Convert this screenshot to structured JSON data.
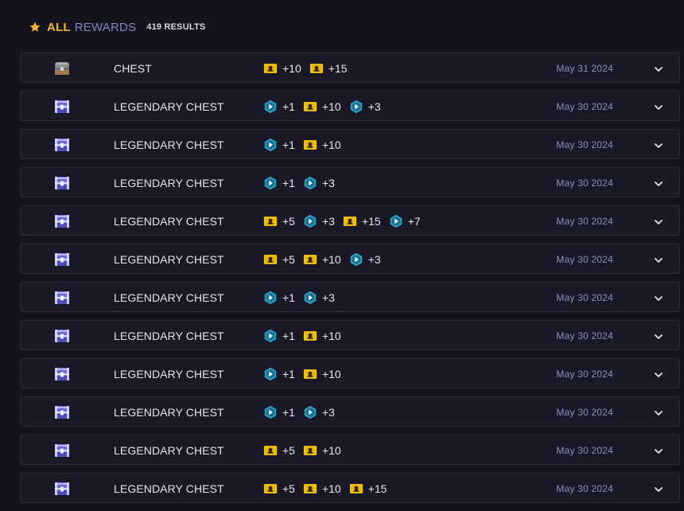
{
  "header": {
    "all_label": "ALL",
    "rewards_label": "REWARDS",
    "results_label": "419 RESULTS"
  },
  "colors": {
    "accent": "#f3b23a",
    "muted": "#7f86c0",
    "date": "#8a8fc4",
    "row_bg": "#191927",
    "page_bg": "#14141f"
  },
  "icons": {
    "star": "star-icon",
    "ticket": "ticket-icon",
    "hex": "hex-token-icon",
    "chest": "chest-icon",
    "legendary_chest": "legendary-chest-icon",
    "chevron": "chevron-down-icon"
  },
  "rows": [
    {
      "name": "CHEST",
      "chest": "chest",
      "date": "May 31 2024",
      "items": [
        {
          "icon": "ticket",
          "amount": "+10"
        },
        {
          "icon": "ticket",
          "amount": "+15"
        }
      ]
    },
    {
      "name": "LEGENDARY CHEST",
      "chest": "legendary",
      "date": "May 30 2024",
      "items": [
        {
          "icon": "hex",
          "amount": "+1"
        },
        {
          "icon": "ticket",
          "amount": "+10"
        },
        {
          "icon": "hex",
          "amount": "+3"
        }
      ]
    },
    {
      "name": "LEGENDARY CHEST",
      "chest": "legendary",
      "date": "May 30 2024",
      "items": [
        {
          "icon": "hex",
          "amount": "+1"
        },
        {
          "icon": "ticket",
          "amount": "+10"
        }
      ]
    },
    {
      "name": "LEGENDARY CHEST",
      "chest": "legendary",
      "date": "May 30 2024",
      "items": [
        {
          "icon": "hex",
          "amount": "+1"
        },
        {
          "icon": "hex",
          "amount": "+3"
        }
      ]
    },
    {
      "name": "LEGENDARY CHEST",
      "chest": "legendary",
      "date": "May 30 2024",
      "items": [
        {
          "icon": "ticket",
          "amount": "+5"
        },
        {
          "icon": "hex",
          "amount": "+3"
        },
        {
          "icon": "ticket",
          "amount": "+15"
        },
        {
          "icon": "hex",
          "amount": "+7"
        }
      ]
    },
    {
      "name": "LEGENDARY CHEST",
      "chest": "legendary",
      "date": "May 30 2024",
      "items": [
        {
          "icon": "ticket",
          "amount": "+5"
        },
        {
          "icon": "ticket",
          "amount": "+10"
        },
        {
          "icon": "hex",
          "amount": "+3"
        }
      ]
    },
    {
      "name": "LEGENDARY CHEST",
      "chest": "legendary",
      "date": "May 30 2024",
      "items": [
        {
          "icon": "hex",
          "amount": "+1"
        },
        {
          "icon": "hex",
          "amount": "+3"
        }
      ]
    },
    {
      "name": "LEGENDARY CHEST",
      "chest": "legendary",
      "date": "May 30 2024",
      "items": [
        {
          "icon": "hex",
          "amount": "+1"
        },
        {
          "icon": "ticket",
          "amount": "+10"
        }
      ]
    },
    {
      "name": "LEGENDARY CHEST",
      "chest": "legendary",
      "date": "May 30 2024",
      "items": [
        {
          "icon": "hex",
          "amount": "+1"
        },
        {
          "icon": "ticket",
          "amount": "+10"
        }
      ]
    },
    {
      "name": "LEGENDARY CHEST",
      "chest": "legendary",
      "date": "May 30 2024",
      "items": [
        {
          "icon": "hex",
          "amount": "+1"
        },
        {
          "icon": "hex",
          "amount": "+3"
        }
      ]
    },
    {
      "name": "LEGENDARY CHEST",
      "chest": "legendary",
      "date": "May 30 2024",
      "items": [
        {
          "icon": "ticket",
          "amount": "+5"
        },
        {
          "icon": "ticket",
          "amount": "+10"
        }
      ]
    },
    {
      "name": "LEGENDARY CHEST",
      "chest": "legendary",
      "date": "May 30 2024",
      "items": [
        {
          "icon": "ticket",
          "amount": "+5"
        },
        {
          "icon": "ticket",
          "amount": "+10"
        },
        {
          "icon": "ticket",
          "amount": "+15"
        }
      ]
    }
  ]
}
